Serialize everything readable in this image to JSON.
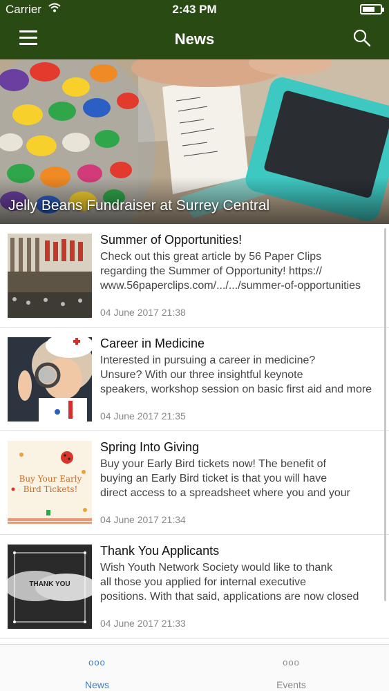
{
  "status_bar": {
    "carrier": "Carrier",
    "time": "2:43 PM",
    "battery_level": 0.7
  },
  "nav": {
    "title": "News"
  },
  "hero": {
    "title": "Jelly Beans Fundraiser at Surrey Central"
  },
  "articles": [
    {
      "title": "Summer of Opportunities!",
      "summary_lines": [
        "Check out this great article by 56 Paper Clips",
        "regarding the Summer of Opportunity! https://",
        "www.56paperclips.com/.../.../summer-of-opportunities"
      ],
      "date": "04 June 2017 21:38"
    },
    {
      "title": "Career in Medicine",
      "summary_lines": [
        "Interested in pursuing a career in medicine?",
        "Unsure? With our three insightful keynote",
        "speakers, workshop session on basic first aid and more"
      ],
      "date": "04 June 2017 21:35"
    },
    {
      "title": "Spring Into Giving",
      "summary_lines": [
        "Buy your Early Bird tickets now!  The benefit of",
        "buying an Early Bird ticket is that you will have",
        "direct access to a spreadsheet where you and your"
      ],
      "date": "04 June 2017 21:34",
      "thumb_text": "Buy Your Early Bird Tickets!"
    },
    {
      "title": "Thank You Applicants",
      "summary_lines": [
        "Wish Youth Network Society would like to thank",
        "all those you applied for internal executive",
        "positions. With that said, applications are now closed"
      ],
      "date": "04 June 2017 21:33",
      "thumb_text": "THANK YOU"
    }
  ],
  "tabs": [
    {
      "label": "News",
      "icon": "ooo",
      "active": true
    },
    {
      "label": "Events",
      "icon": "ooo",
      "active": false
    }
  ],
  "colors": {
    "bar": "#2a4a14",
    "tab_active": "#3d7bbf",
    "tab_inactive": "#888888"
  }
}
